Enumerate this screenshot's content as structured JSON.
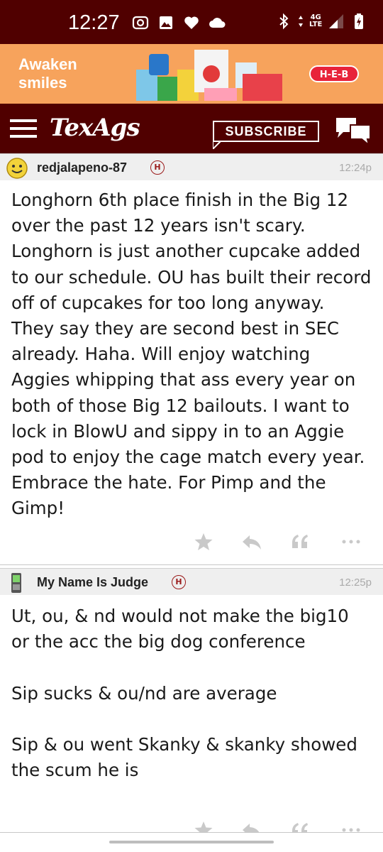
{
  "status_bar": {
    "time": "12:27",
    "network": "4G\nLTE",
    "icons": [
      "screen-record-icon",
      "image-icon",
      "heart-icon",
      "cloud-icon",
      "bluetooth-icon",
      "data-arrows-icon",
      "signal-icon",
      "battery-charging-icon"
    ]
  },
  "ad": {
    "text": "Awaken\nsmiles",
    "brand": "H-E-B",
    "background": "#f7a35c"
  },
  "nav": {
    "logo": "TexAgs",
    "subscribe_label": "SUBSCRIBE",
    "background": "#500000"
  },
  "posts": [
    {
      "username": "redjalapeno-87",
      "badge": "H",
      "time": "12:24p",
      "body": "Longhorn 6th place finish in the Big 12 over the past 12 years isn't scary. Longhorn is just another cupcake added to our schedule. OU has built their record off of cupcakes for too long anyway. They say they are second best in SEC already. Haha. Will enjoy watching Aggies whipping that ass every year on both of those Big 12 bailouts. I want to lock in BlowU and sippy in to an Aggie pod to enjoy the cage match every year. Embrace the hate. For Pimp and the Gimp!"
    },
    {
      "username": "My Name Is Judge",
      "badge": "H",
      "time": "12:25p",
      "body": "Ut, ou, & nd would not make the big10 or the acc the big dog conference\n\nSip sucks & ou/nd are average\n\nSip & ou went Skanky & skanky showed the scum he is"
    }
  ]
}
